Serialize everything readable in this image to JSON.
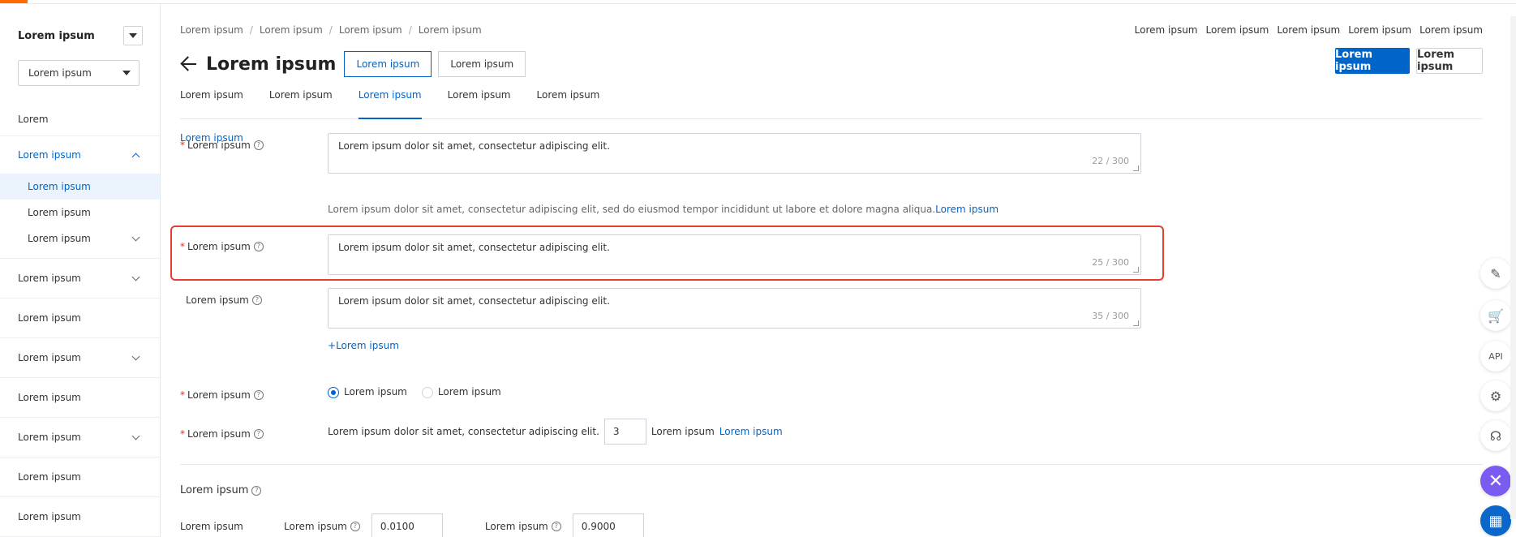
{
  "sidebar": {
    "title": "Lorem ipsum",
    "space_select": "Lorem ipsum",
    "items": [
      {
        "label": "Lorem"
      },
      {
        "label": "Lorem ipsum",
        "expanded": true,
        "children": [
          {
            "label": "Lorem ipsum",
            "active": true
          },
          {
            "label": "Lorem ipsum"
          },
          {
            "label": "Lorem ipsum"
          }
        ]
      },
      {
        "label": "Lorem ipsum"
      },
      {
        "label": "Lorem ipsum"
      },
      {
        "label": "Lorem ipsum"
      },
      {
        "label": "Lorem ipsum"
      },
      {
        "label": "Lorem ipsum"
      },
      {
        "label": "Lorem ipsum"
      },
      {
        "label": "Lorem ipsum"
      }
    ]
  },
  "breadcrumb": [
    "Lorem ipsum",
    "Lorem ipsum",
    "Lorem ipsum",
    "Lorem ipsum"
  ],
  "top_links": [
    "Lorem ipsum",
    "Lorem ipsum",
    "Lorem ipsum",
    "Lorem ipsum",
    "Lorem ipsum"
  ],
  "header": {
    "title": "Lorem ipsum",
    "env_test": "Lorem ipsum",
    "env_prod": "Lorem ipsum",
    "publish_button": "Lorem ipsum",
    "publish_record_button": "Lorem ipsum"
  },
  "tabs": [
    {
      "label": "Lorem ipsum"
    },
    {
      "label": "Lorem ipsum"
    },
    {
      "label": "Lorem ipsum",
      "active": true
    },
    {
      "label": "Lorem ipsum"
    },
    {
      "label": "Lorem ipsum"
    }
  ],
  "content": {
    "course_link": "Lorem ipsum",
    "welcome": {
      "label": "Lorem ipsum",
      "value": "Lorem ipsum dolor sit amet, consectetur adipiscing elit.",
      "count": "22 / 300"
    },
    "hint_text": "Lorem ipsum dolor sit amet, consectetur adipiscing elit, sed do eiusmod tempor incididunt ut labore et dolore magna aliqua.",
    "hint_link": "Lorem ipsum",
    "sensitive": {
      "label": "Lorem ipsum",
      "value": "Lorem ipsum dolor sit amet, consectetur adipiscing elit.",
      "count": "25 / 300"
    },
    "no_answer": {
      "label": "Lorem ipsum",
      "value": "Lorem ipsum dolor sit amet, consectetur adipiscing elit.",
      "count": "35 / 300"
    },
    "add_no_answer": "Lorem ipsum",
    "strategy": {
      "label": "Lorem ipsum",
      "option1": "Lorem ipsum",
      "option2": "Lorem ipsum"
    },
    "clarify": {
      "label": "Lorem ipsum",
      "prefix": "Lorem ipsum dolor sit amet, consectetur adipiscing elit.",
      "value": "3",
      "suffix": "Lorem ipsum",
      "config_link": "Lorem ipsum"
    },
    "threshold": {
      "title": "Lorem ipsum",
      "faq_label": "Lorem ipsum",
      "clarify_label": "Lorem ipsum",
      "clarify_value": "0.0100",
      "direct_label": "Lorem ipsum",
      "direct_value": "0.9000"
    }
  },
  "colors": {
    "accent": "#0064c8",
    "highlight": "#e53d2f",
    "required": "#e0301e",
    "top_accent": "#ff6a00"
  },
  "floating_tools": [
    "edit-icon",
    "cart-icon",
    "api-icon",
    "settings-icon",
    "support-icon",
    "close-icon",
    "apps-icon"
  ]
}
